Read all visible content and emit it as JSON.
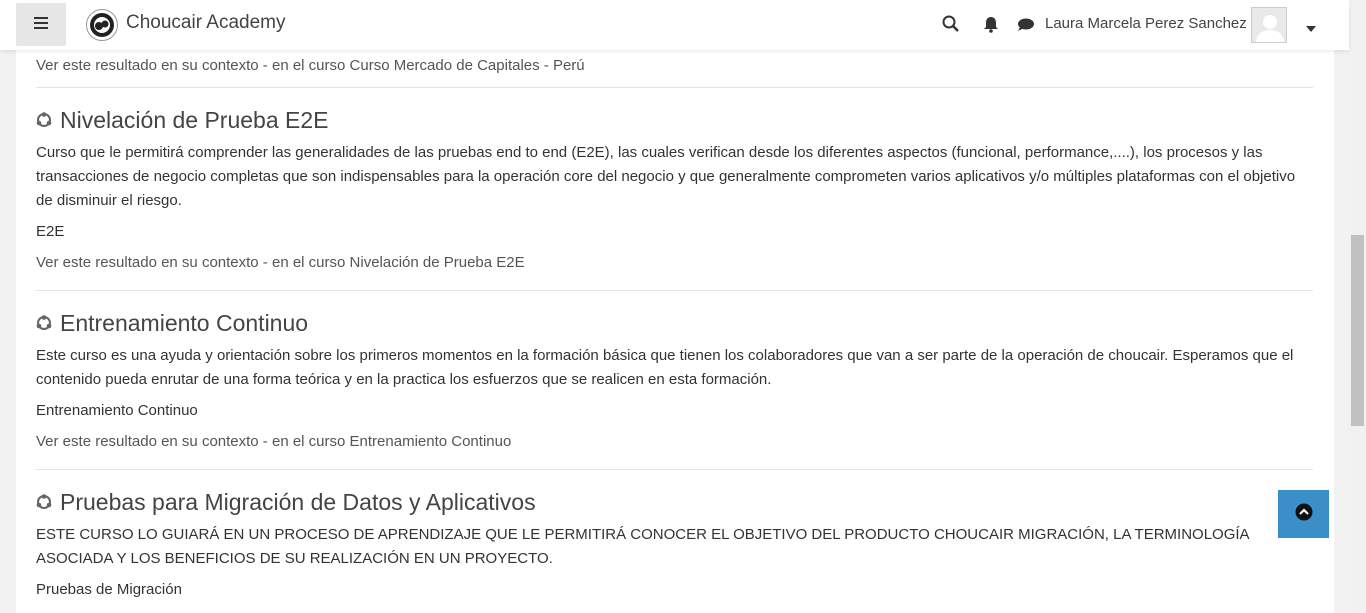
{
  "navbar": {
    "brand": "Choucair Academy",
    "user_name": "Laura Marcela Perez Sanchez",
    "icons": [
      "hamburger-icon",
      "search-icon",
      "bell-icon",
      "chat-icon",
      "caret-down-icon"
    ]
  },
  "results": [
    {
      "context_prefix": "Ver este resultado en su contexto - en el curso",
      "context_course": "Curso Mercado de Capitales - Perú"
    },
    {
      "title": "Nivelación de Prueba E2E",
      "summary": "Curso que le permitirá comprender las generalidades de las pruebas end to end (E2E), las cuales verifican desde los diferentes aspectos (funcional, performance,....), los procesos y las transacciones de negocio completas que son indispensables para la operación core del negocio y que generalmente comprometen varios aplicativos y/o múltiples plataformas con el objetivo de disminuir el riesgo.",
      "tag": "E2E",
      "context_prefix": "Ver este resultado en su contexto - en el curso",
      "context_course": "Nivelación de Prueba E2E"
    },
    {
      "title": "Entrenamiento Continuo",
      "summary": "Este curso es una ayuda y orientación sobre los primeros momentos en la formación básica que tienen los colaboradores que van a ser parte de la operación de choucair. Esperamos que el contenido pueda enrutar de una forma teórica y en la practica los esfuerzos que se realicen en esta formación.",
      "tag": "Entrenamiento Continuo",
      "context_prefix": "Ver este resultado en su contexto - en el curso",
      "context_course": "Entrenamiento Continuo"
    },
    {
      "title": "Pruebas para Migración de Datos y Aplicativos",
      "summary": "ESTE CURSO LO GUIARÁ EN UN PROCESO DE APRENDIZAJE QUE LE PERMITIRÁ CONOCER EL OBJETIVO DEL PRODUCTO CHOUCAIR MIGRACIÓN, LA TERMINOLOGÍA ASOCIADA Y LOS BENEFICIOS DE SU REALIZACIÓN EN UN PROYECTO.",
      "tag": "Pruebas de Migración"
    }
  ],
  "colors": {
    "accent": "#3a8fc8",
    "navbar_bg": "#ffffff",
    "page_bg": "#f2f2f2"
  }
}
